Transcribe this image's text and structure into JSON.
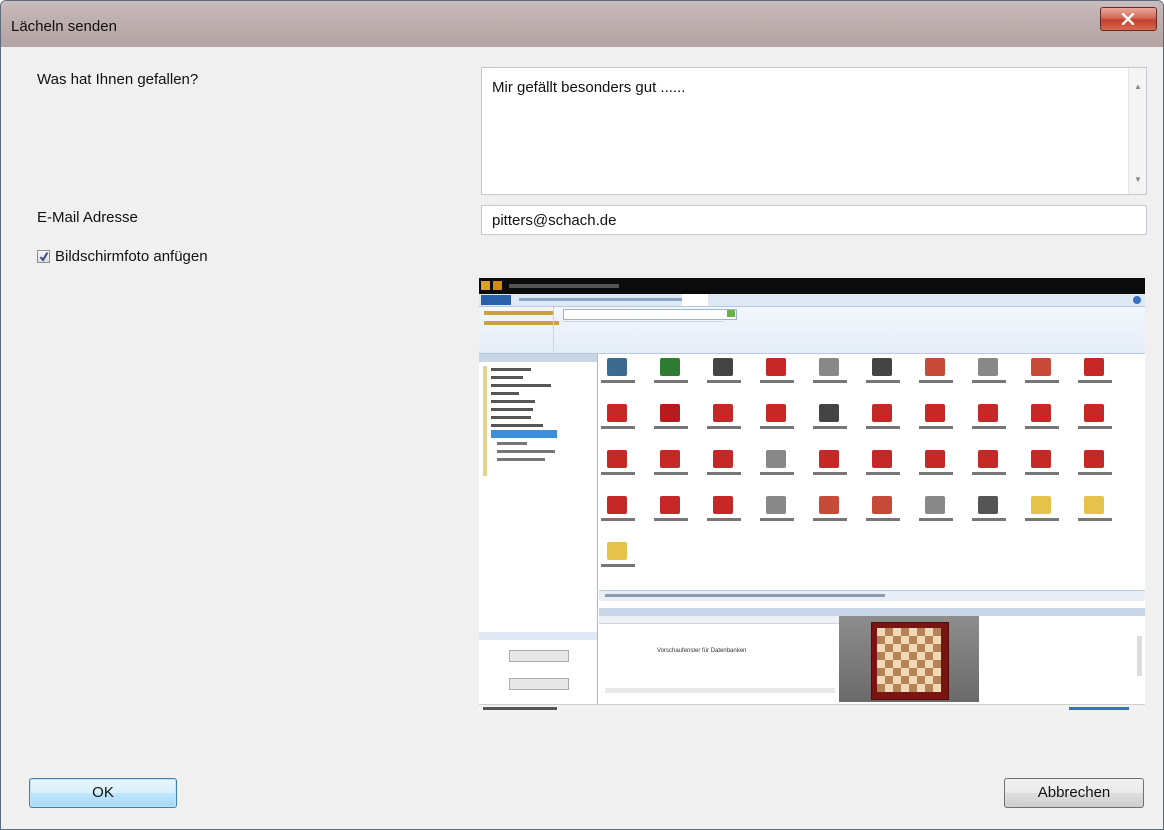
{
  "window": {
    "title": "Lächeln senden"
  },
  "form": {
    "feedback_label": "Was hat Ihnen gefallen?",
    "feedback_value": "Mir gefällt besonders gut ......",
    "email_label": "E-Mail Adresse",
    "email_value": "pitters@schach.de",
    "screenshot_checkbox_label": "Bildschirmfoto anfügen",
    "screenshot_checked": true
  },
  "screenshot_preview": {
    "inner_text": "Vorschaufenster für Datenbanken"
  },
  "buttons": {
    "ok": "OK",
    "cancel": "Abbrechen"
  },
  "colors": {
    "titlebar": "#bfb0b0",
    "close": "#c2412b",
    "ok_border": "#3c7fb1"
  }
}
